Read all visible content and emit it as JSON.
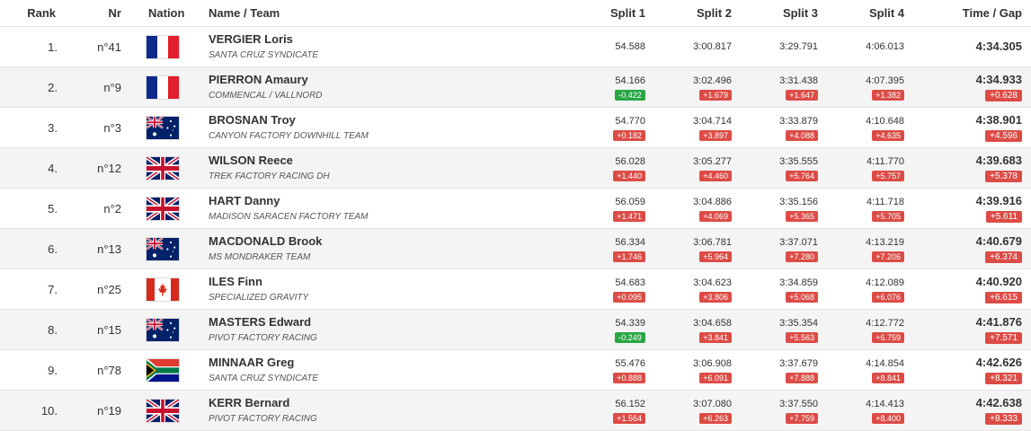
{
  "headers": {
    "rank": "Rank",
    "nr": "Nr",
    "nation": "Nation",
    "name": "Name / Team",
    "split1": "Split 1",
    "split2": "Split 2",
    "split3": "Split 3",
    "split4": "Split 4",
    "time": "Time / Gap"
  },
  "colors": {
    "gap_positive": "#dc4c46",
    "gap_negative": "#28a745"
  },
  "rows": [
    {
      "rank": "1.",
      "nr": "n°41",
      "flag": "fra",
      "name": "VERGIER Loris",
      "team": "SANTA CRUZ SYNDICATE",
      "s1": "54.588",
      "s2": "3:00.817",
      "s3": "3:29.791",
      "s4": "4:06.013",
      "time": "4:34.305"
    },
    {
      "rank": "2.",
      "nr": "n°9",
      "flag": "fra",
      "name": "PIERRON Amaury",
      "team": "COMMENCAL / VALLNORD",
      "s1": "54.166",
      "s1g": "-0.422",
      "s2": "3:02.496",
      "s2g": "+1.679",
      "s3": "3:31.438",
      "s3g": "+1.647",
      "s4": "4:07.395",
      "s4g": "+1.382",
      "time": "4:34.933",
      "gap": "+0.628"
    },
    {
      "rank": "3.",
      "nr": "n°3",
      "flag": "aus",
      "name": "BROSNAN Troy",
      "team": "CANYON FACTORY DOWNHILL TEAM",
      "s1": "54.770",
      "s1g": "+0.182",
      "s2": "3:04.714",
      "s2g": "+3.897",
      "s3": "3:33.879",
      "s3g": "+4.088",
      "s4": "4:10.648",
      "s4g": "+4.635",
      "time": "4:38.901",
      "gap": "+4.596"
    },
    {
      "rank": "4.",
      "nr": "n°12",
      "flag": "gbr",
      "name": "WILSON Reece",
      "team": "TREK FACTORY RACING DH",
      "s1": "56.028",
      "s1g": "+1.440",
      "s2": "3:05.277",
      "s2g": "+4.460",
      "s3": "3:35.555",
      "s3g": "+5.764",
      "s4": "4:11.770",
      "s4g": "+5.757",
      "time": "4:39.683",
      "gap": "+5.378"
    },
    {
      "rank": "5.",
      "nr": "n°2",
      "flag": "gbr",
      "name": "HART Danny",
      "team": "MADISON SARACEN FACTORY TEAM",
      "s1": "56.059",
      "s1g": "+1.471",
      "s2": "3:04.886",
      "s2g": "+4.069",
      "s3": "3:35.156",
      "s3g": "+5.365",
      "s4": "4:11.718",
      "s4g": "+5.705",
      "time": "4:39.916",
      "gap": "+5.611"
    },
    {
      "rank": "6.",
      "nr": "n°13",
      "flag": "aus",
      "name": "MACDONALD Brook",
      "team": "MS MONDRAKER TEAM",
      "s1": "56.334",
      "s1g": "+1.746",
      "s2": "3:06.781",
      "s2g": "+5.964",
      "s3": "3:37.071",
      "s3g": "+7.280",
      "s4": "4:13.219",
      "s4g": "+7.206",
      "time": "4:40.679",
      "gap": "+6.374"
    },
    {
      "rank": "7.",
      "nr": "n°25",
      "flag": "can",
      "name": "ILES Finn",
      "team": "SPECIALIZED GRAVITY",
      "s1": "54.683",
      "s1g": "+0.095",
      "s2": "3:04.623",
      "s2g": "+3.806",
      "s3": "3:34.859",
      "s3g": "+5.068",
      "s4": "4:12.089",
      "s4g": "+6.076",
      "time": "4:40.920",
      "gap": "+6.615"
    },
    {
      "rank": "8.",
      "nr": "n°15",
      "flag": "aus",
      "name": "MASTERS Edward",
      "team": "PIVOT FACTORY RACING",
      "s1": "54.339",
      "s1g": "-0.249",
      "s2": "3:04.658",
      "s2g": "+3.841",
      "s3": "3:35.354",
      "s3g": "+5.563",
      "s4": "4:12.772",
      "s4g": "+6.759",
      "time": "4:41.876",
      "gap": "+7.571"
    },
    {
      "rank": "9.",
      "nr": "n°78",
      "flag": "rsa",
      "name": "MINNAAR Greg",
      "team": "SANTA CRUZ SYNDICATE",
      "s1": "55.476",
      "s1g": "+0.888",
      "s2": "3:06.908",
      "s2g": "+6.091",
      "s3": "3:37.679",
      "s3g": "+7.888",
      "s4": "4:14.854",
      "s4g": "+8.841",
      "time": "4:42.626",
      "gap": "+8.321"
    },
    {
      "rank": "10.",
      "nr": "n°19",
      "flag": "gbr",
      "name": "KERR Bernard",
      "team": "PIVOT FACTORY RACING",
      "s1": "56.152",
      "s1g": "+1.564",
      "s2": "3:07.080",
      "s2g": "+6.263",
      "s3": "3:37.550",
      "s3g": "+7.759",
      "s4": "4:14.413",
      "s4g": "+8.400",
      "time": "4:42.638",
      "gap": "+8.333"
    }
  ]
}
